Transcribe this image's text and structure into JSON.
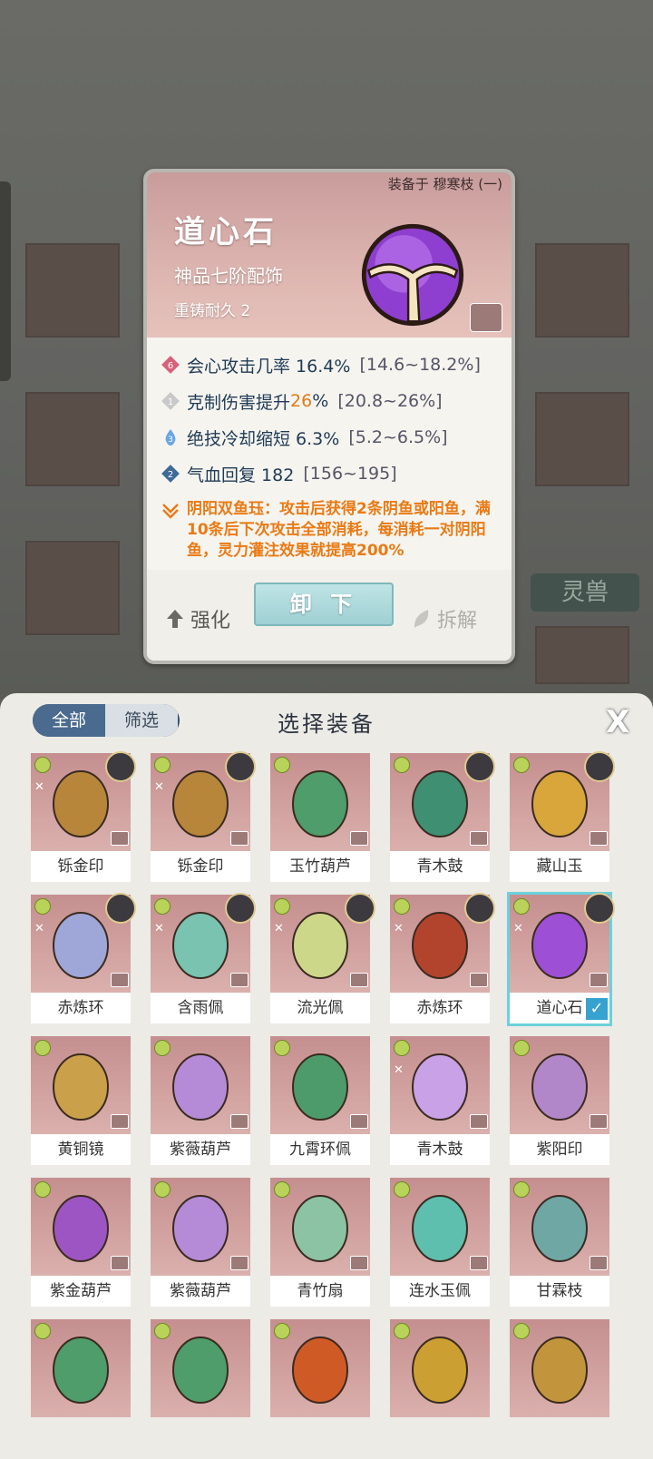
{
  "background": {
    "side_tab": "灵兽"
  },
  "detail": {
    "equipped_on": "装备于 穆寒枝 (一)",
    "name": "道心石",
    "grade": "神品七阶配饰",
    "reforge": "重铸耐久 2",
    "stats": [
      {
        "badge": "6",
        "text": "会心攻击几率 16.4%",
        "range": "[14.6~18.2%]"
      },
      {
        "badge": "1",
        "text_pre": "克制伤害提升",
        "text_hl": "26",
        "text_post": "%",
        "range": "[20.8~26%]"
      },
      {
        "badge": "3",
        "text": "绝技冷却缩短 6.3%",
        "range": "[5.2~6.5%]"
      },
      {
        "badge": "2",
        "text": "气血回复 182",
        "range": "[156~195]"
      }
    ],
    "passive": "阴阳双鱼珏：攻击后获得2条阴鱼或阳鱼，满10条后下次攻击全部消耗，每消耗一对阴阳鱼，灵力灌注效果就提高200%",
    "actions": {
      "strengthen": "强化",
      "unequip": "卸 下",
      "dismantle": "拆解"
    }
  },
  "selector": {
    "filter_all": "全部",
    "filter_screen": "筛选",
    "title": "选择装备",
    "close": "X",
    "items": [
      {
        "name": "铄金印",
        "color": "#b8863b"
      },
      {
        "name": "铄金印",
        "color": "#b8863b"
      },
      {
        "name": "玉竹葫芦",
        "color": "#4e9d6a"
      },
      {
        "name": "青木鼓",
        "color": "#3f8f73"
      },
      {
        "name": "藏山玉",
        "color": "#d9a63c"
      },
      {
        "name": "赤炼环",
        "color": "#9ea7d8"
      },
      {
        "name": "含雨佩",
        "color": "#79c3b0"
      },
      {
        "name": "流光佩",
        "color": "#cdd78a"
      },
      {
        "name": "赤炼环",
        "color": "#b2442e"
      },
      {
        "name": "道心石",
        "color": "#9d4fd6"
      },
      {
        "name": "黄铜镜",
        "color": "#caa04a"
      },
      {
        "name": "紫薇葫芦",
        "color": "#b58bd8"
      },
      {
        "name": "九霄环佩",
        "color": "#4d9b6b"
      },
      {
        "name": "青木鼓",
        "color": "#c8a1e6"
      },
      {
        "name": "紫阳印",
        "color": "#b287c9"
      },
      {
        "name": "紫金葫芦",
        "color": "#9d55c4"
      },
      {
        "name": "紫薇葫芦",
        "color": "#b58bd8"
      },
      {
        "name": "青竹扇",
        "color": "#8bc3a4"
      },
      {
        "name": "连水玉佩",
        "color": "#5ebfae"
      },
      {
        "name": "甘霖枝",
        "color": "#6fa7a5"
      },
      {
        "name": "",
        "color": "#4e9d6a"
      },
      {
        "name": "",
        "color": "#4e9d6a"
      },
      {
        "name": "",
        "color": "#d05a26"
      },
      {
        "name": "",
        "color": "#cc9f32"
      },
      {
        "name": "",
        "color": "#c2953c"
      }
    ]
  }
}
